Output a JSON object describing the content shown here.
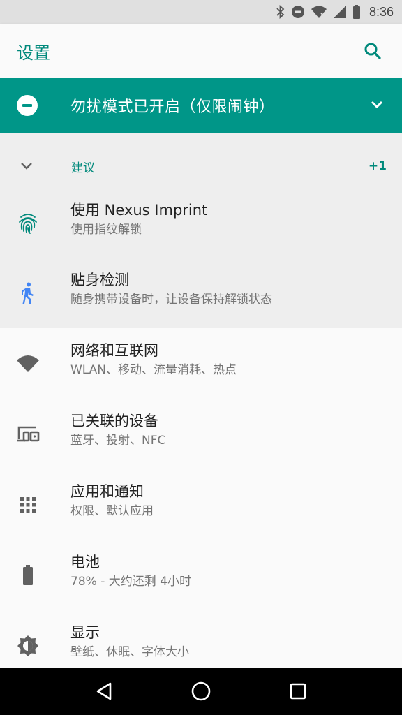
{
  "status_bar": {
    "time": "8:36"
  },
  "app_bar": {
    "title": "设置"
  },
  "dnd_banner": {
    "text": "勿扰模式已开启（仅限闹钟）"
  },
  "suggestions": {
    "title": "建议",
    "count": "+1",
    "items": [
      {
        "title": "使用 Nexus Imprint",
        "subtitle": "使用指纹解锁",
        "icon": "fingerprint-icon"
      },
      {
        "title": "贴身检测",
        "subtitle": "随身携带设备时，让设备保持解锁状态",
        "icon": "walking-person-icon"
      }
    ]
  },
  "settings": [
    {
      "title": "网络和互联网",
      "subtitle": "WLAN、移动、流量消耗、热点",
      "icon": "wifi-icon"
    },
    {
      "title": "已关联的设备",
      "subtitle": "蓝牙、投射、NFC",
      "icon": "devices-icon"
    },
    {
      "title": "应用和通知",
      "subtitle": "权限、默认应用",
      "icon": "apps-grid-icon"
    },
    {
      "title": "电池",
      "subtitle": "78% - 大约还剩 4小时",
      "icon": "battery-icon"
    },
    {
      "title": "显示",
      "subtitle": "壁纸、休眠、字体大小",
      "icon": "brightness-icon"
    }
  ],
  "colors": {
    "accent": "#009688",
    "accent_text": "#00897b",
    "icon_gray": "#616161",
    "walk_blue": "#4285f4"
  }
}
